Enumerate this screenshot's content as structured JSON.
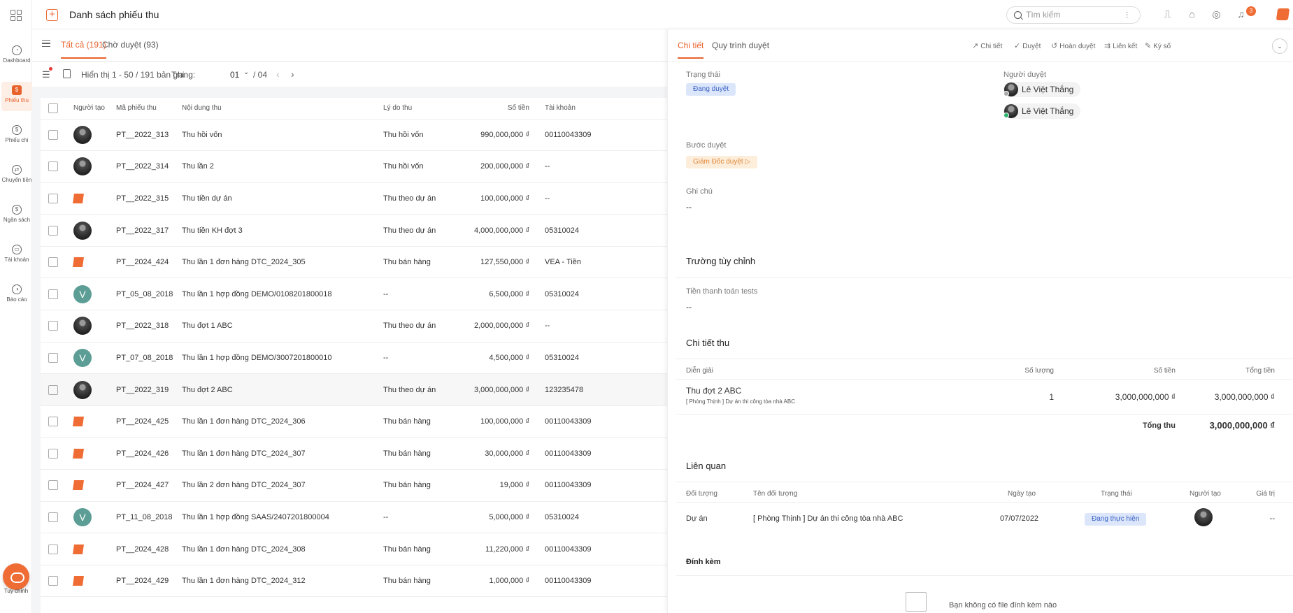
{
  "app": {
    "title": "Danh sách phiếu thu"
  },
  "sidebar": {
    "items": [
      {
        "label": "Dashboard",
        "icon": "dashboard-icon",
        "glyph": "◔"
      },
      {
        "label": "Phiếu thu",
        "icon": "receipt-icon",
        "glyph": "$",
        "active": true
      },
      {
        "label": "Phiếu chi",
        "icon": "payment-icon",
        "glyph": "$"
      },
      {
        "label": "Chuyển tiền",
        "icon": "transfer-icon",
        "glyph": "⇄"
      },
      {
        "label": "Ngân sách",
        "icon": "budget-icon",
        "glyph": "$"
      },
      {
        "label": "Tài khoản",
        "icon": "wallet-icon",
        "glyph": "▭"
      },
      {
        "label": "Báo cáo",
        "icon": "report-icon",
        "glyph": "◑"
      }
    ],
    "help_label": "Tuỳ chỉnh"
  },
  "topbar": {
    "search_placeholder": "Tìm kiếm",
    "notification_count": "3"
  },
  "list": {
    "tabs": [
      {
        "label": "Tất cả (191)",
        "active": true
      },
      {
        "label": "Chờ duyệt (93)",
        "active": false
      }
    ],
    "showing": "Hiển thị 1 - 50 / 191 bản ghi",
    "page_label": "Trang:",
    "page_current": "01",
    "page_total": "/ 04",
    "columns": {
      "creator": "Người tạo",
      "code": "Mã phiếu thu",
      "content": "Nội dung thu",
      "reason": "Lý do thu",
      "amount": "Số tiền",
      "account": "Tài khoản"
    },
    "rows": [
      {
        "avatar": "photo",
        "code": "PT__2022_313",
        "content": "Thu hồi vốn",
        "reason": "Thu hồi vốn",
        "amount": "990,000,000 ₫",
        "account": "00110043309"
      },
      {
        "avatar": "photo",
        "code": "PT__2022_314",
        "content": "Thu lần 2",
        "reason": "Thu hồi vốn",
        "amount": "200,000,000 ₫",
        "account": "--"
      },
      {
        "avatar": "logo",
        "code": "PT__2022_315",
        "content": "Thu tiền dự án",
        "reason": "Thu theo dự án",
        "amount": "100,000,000 ₫",
        "account": "--"
      },
      {
        "avatar": "photo",
        "code": "PT__2022_317",
        "content": "Thu tiền KH đợt 3",
        "reason": "Thu theo dự án",
        "amount": "4,000,000,000 ₫",
        "account": "05310024"
      },
      {
        "avatar": "logo",
        "code": "PT__2024_424",
        "content": "Thu lần 1 đơn hàng DTC_2024_305",
        "reason": "Thu bán hàng",
        "amount": "127,550,000 ₫",
        "account": "VEA - Tiền"
      },
      {
        "avatar": "V",
        "code": "PT_05_08_2018",
        "content": "Thu lần 1 hợp đồng DEMO/0108201800018",
        "reason": "--",
        "amount": "6,500,000 ₫",
        "account": "05310024"
      },
      {
        "avatar": "photo",
        "code": "PT__2022_318",
        "content": "Thu đợt 1 ABC",
        "reason": "Thu theo dự án",
        "amount": "2,000,000,000 ₫",
        "account": "--"
      },
      {
        "avatar": "V",
        "code": "PT_07_08_2018",
        "content": "Thu lần 1 hợp đồng DEMO/3007201800010",
        "reason": "--",
        "amount": "4,500,000 ₫",
        "account": "05310024"
      },
      {
        "avatar": "photo",
        "code": "PT__2022_319",
        "content": "Thu đợt 2 ABC",
        "reason": "Thu theo dự án",
        "amount": "3,000,000,000 ₫",
        "account": "123235478",
        "highlight": true
      },
      {
        "avatar": "logo",
        "code": "PT__2024_425",
        "content": "Thu lần 1 đơn hàng DTC_2024_306",
        "reason": "Thu bán hàng",
        "amount": "100,000,000 ₫",
        "account": "00110043309"
      },
      {
        "avatar": "logo",
        "code": "PT__2024_426",
        "content": "Thu lần 1 đơn hàng DTC_2024_307",
        "reason": "Thu bán hàng",
        "amount": "30,000,000 ₫",
        "account": "00110043309"
      },
      {
        "avatar": "logo",
        "code": "PT__2024_427",
        "content": "Thu lần 2 đơn hàng DTC_2024_307",
        "reason": "Thu bán hàng",
        "amount": "19,000 ₫",
        "account": "00110043309"
      },
      {
        "avatar": "V",
        "code": "PT_11_08_2018",
        "content": "Thu lần 1 hợp đồng SAAS/2407201800004",
        "reason": "--",
        "amount": "5,000,000 ₫",
        "account": "05310024"
      },
      {
        "avatar": "logo",
        "code": "PT__2024_428",
        "content": "Thu lần 1 đơn hàng DTC_2024_308",
        "reason": "Thu bán hàng",
        "amount": "11,220,000 ₫",
        "account": "00110043309"
      },
      {
        "avatar": "logo",
        "code": "PT__2024_429",
        "content": "Thu lần 1 đơn hàng DTC_2024_312",
        "reason": "Thu bán hàng",
        "amount": "1,000,000 ₫",
        "account": "00110043309"
      }
    ]
  },
  "detail": {
    "tabs": [
      {
        "label": "Chi tiết",
        "active": true
      },
      {
        "label": "Quy trình duyệt",
        "active": false
      }
    ],
    "actions": [
      {
        "label": "Chi tiết",
        "glyph": "↗"
      },
      {
        "label": "Duyệt",
        "glyph": "✓"
      },
      {
        "label": "Hoàn duyệt",
        "glyph": "↺"
      },
      {
        "label": "Liên kết",
        "glyph": "⇉"
      },
      {
        "label": "Ký số",
        "glyph": "✎"
      }
    ],
    "status_label": "Trạng thái",
    "status_value": "Đang duyệt",
    "approver_label": "Người duyệt",
    "approvers": [
      "Lê Việt Thắng",
      "Lê Việt Thắng"
    ],
    "step_label": "Bước duyệt",
    "step_value": "Giám Đốc duyệt",
    "note_label": "Ghi chú",
    "note_value": "--",
    "custom_title": "Trường tùy chỉnh",
    "custom_field_label": "Tiền thanh toán tests",
    "custom_field_value": "--",
    "items_title": "Chi tiết thu",
    "items_columns": {
      "desc": "Diễn giải",
      "qty": "Số lượng",
      "amount": "Số tiền",
      "total": "Tổng tiền"
    },
    "items": [
      {
        "desc": "Thu đợt 2 ABC",
        "sub": "[ Phòng Thịnh ] Dự án thi công tòa nhà ABC",
        "qty": "1",
        "amount": "3,000,000,000 ₫",
        "total": "3,000,000,000 ₫"
      }
    ],
    "sum_label": "Tổng thu",
    "sum_value": "3,000,000,000 ₫",
    "related_title": "Liên quan",
    "related_columns": {
      "type": "Đối tượng",
      "name": "Tên đối tượng",
      "date": "Ngày tạo",
      "status": "Trạng thái",
      "creator": "Người tạo",
      "value": "Giá trị"
    },
    "related": [
      {
        "type": "Dự án",
        "name": "[ Phòng Thịnh ] Dự án thi công tòa nhà ABC",
        "date": "07/07/2022",
        "status": "Đang thực hiện",
        "value": "--"
      }
    ],
    "attach_title": "Đính kèm",
    "attach_empty": "Bạn không có file đính kèm nào"
  }
}
